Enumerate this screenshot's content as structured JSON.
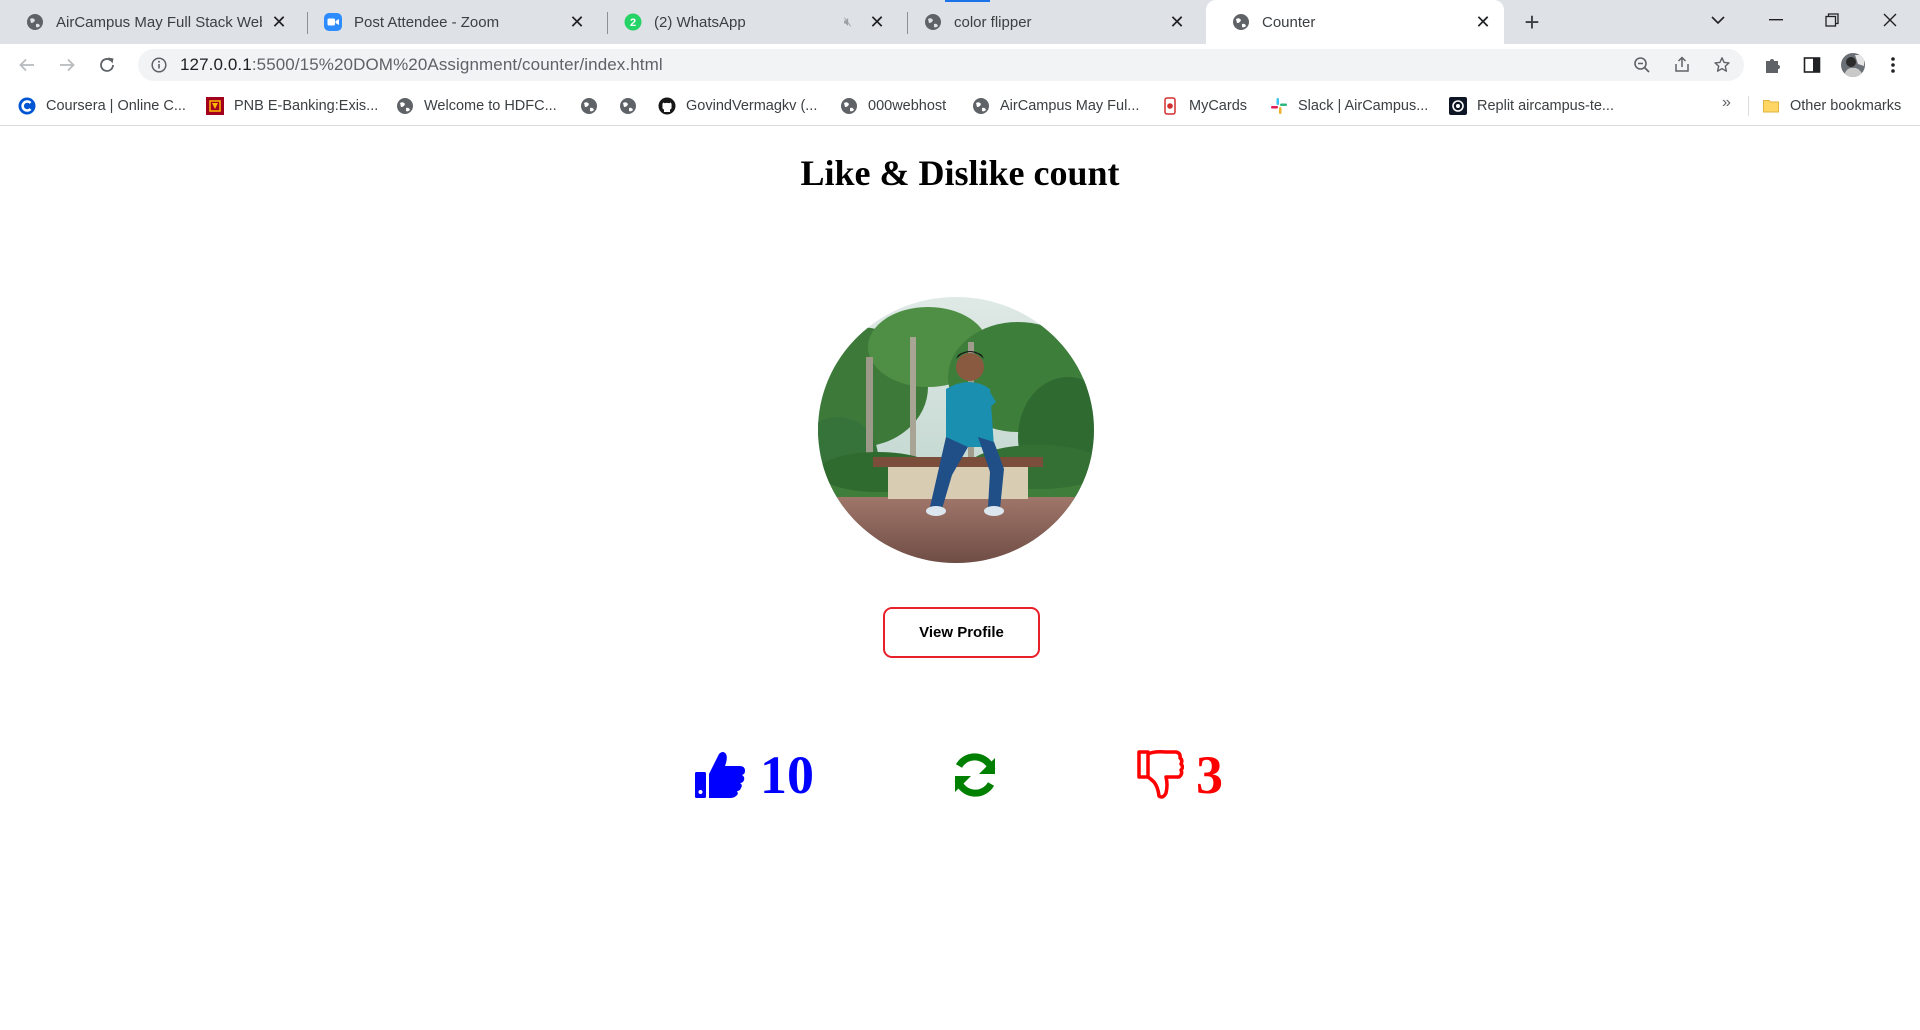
{
  "tabs": [
    {
      "title": "AirCampus May Full Stack Web D",
      "favicon": "globe-icon",
      "active": false
    },
    {
      "title": "Post Attendee - Zoom",
      "favicon": "zoom-icon",
      "active": false
    },
    {
      "title": "(2) WhatsApp",
      "favicon": "whatsapp-icon",
      "badge": "2",
      "muted": true,
      "active": false
    },
    {
      "title": "color flipper",
      "favicon": "globe-icon",
      "active": false
    },
    {
      "title": "Counter",
      "favicon": "globe-icon",
      "active": true
    }
  ],
  "address_bar": {
    "host": "127.0.0.1",
    "path": ":5500/15%20DOM%20Assignment/counter/index.html"
  },
  "bookmarks": [
    {
      "label": "Coursera | Online C...",
      "icon": "coursera-icon"
    },
    {
      "label": "PNB E-Banking:Exis...",
      "icon": "pnb-icon"
    },
    {
      "label": "Welcome to HDFC...",
      "icon": "globe-icon"
    },
    {
      "label": "",
      "icon": "globe-icon"
    },
    {
      "label": "",
      "icon": "globe-icon"
    },
    {
      "label": "GovindVermagkv (...",
      "icon": "github-icon"
    },
    {
      "label": "000webhost",
      "icon": "globe-icon"
    },
    {
      "label": "AirCampus May Ful...",
      "icon": "globe-icon"
    },
    {
      "label": "MyCards",
      "icon": "mycards-icon"
    },
    {
      "label": "Slack | AirCampus...",
      "icon": "slack-icon"
    },
    {
      "label": "Replit aircampus-te...",
      "icon": "replit-icon"
    }
  ],
  "bookmarks_more": "»",
  "other_bookmarks": "Other bookmarks",
  "page": {
    "heading": "Like & Dislike count",
    "view_profile_label": "View Profile",
    "like_count": "10",
    "dislike_count": "3"
  },
  "colors": {
    "like": "#0000ff",
    "refresh": "#008000",
    "dislike": "#ff0000",
    "button_border": "#e8202a"
  }
}
